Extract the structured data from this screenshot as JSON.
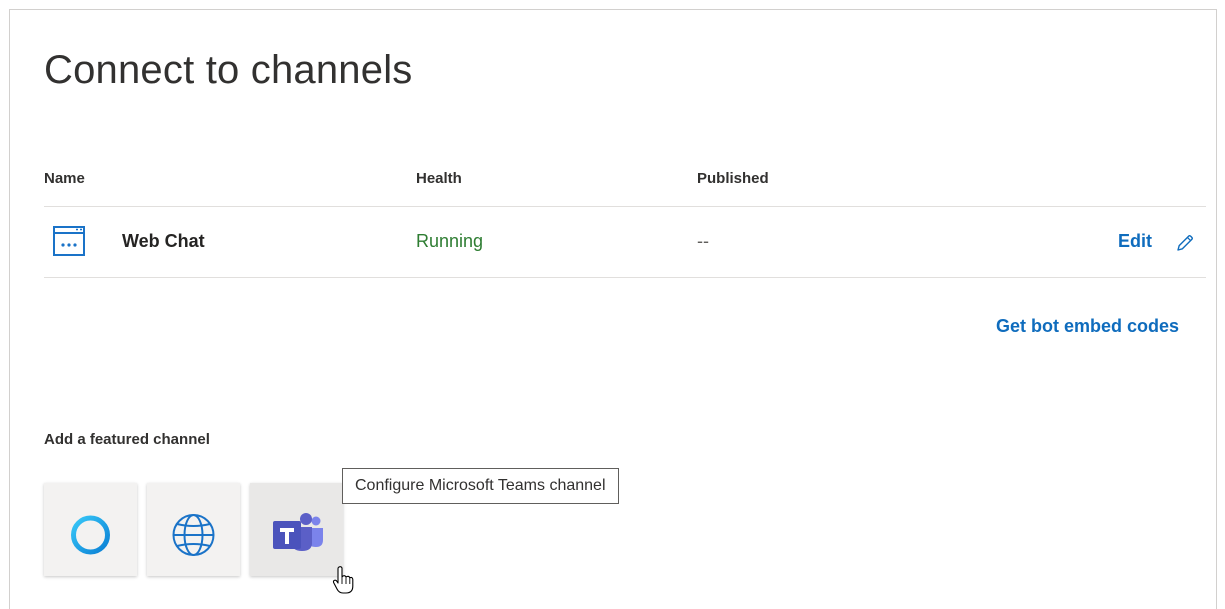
{
  "page": {
    "title": "Connect to channels"
  },
  "table": {
    "columns": [
      "Name",
      "Health",
      "Published"
    ],
    "rows": [
      {
        "icon": "web-chat-icon",
        "name": "Web Chat",
        "health": "Running",
        "published": "--",
        "edit_label": "Edit",
        "edit_icon": "pencil-icon"
      }
    ]
  },
  "links": {
    "embed_codes": "Get bot embed codes"
  },
  "featured": {
    "label": "Add a featured channel",
    "channels": [
      {
        "icon": "cortana-icon"
      },
      {
        "icon": "globe-icon"
      },
      {
        "icon": "microsoft-teams-icon"
      }
    ],
    "tooltip": "Configure Microsoft Teams channel"
  },
  "colors": {
    "accent": "#0f6cbd",
    "health_ok": "#2e7d32",
    "teams": "#5b5fc7",
    "web_chat": "#1a73c8"
  }
}
